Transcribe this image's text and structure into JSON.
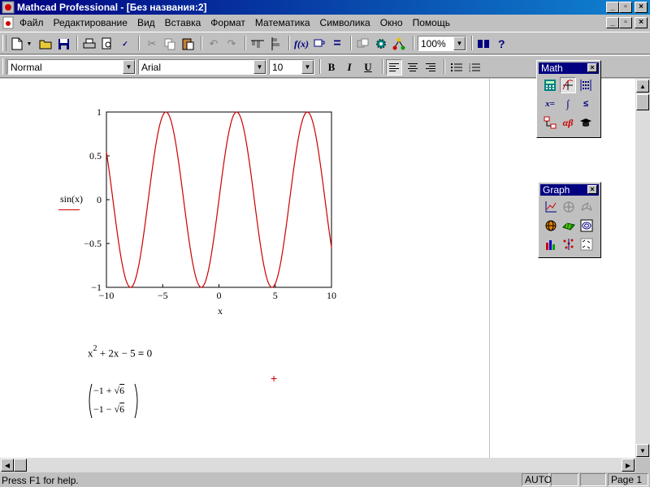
{
  "window": {
    "title": "Mathcad Professional - [Без названия:2]"
  },
  "menu": [
    "Файл",
    "Редактирование",
    "Вид",
    "Вставка",
    "Формат",
    "Математика",
    "Символика",
    "Окно",
    "Помощь"
  ],
  "toolbar": {
    "zoom": "100%"
  },
  "format_toolbar": {
    "style": "Normal",
    "font": "Arial",
    "size": "10",
    "bold": "B",
    "italic": "I",
    "underline": "U"
  },
  "palettes": {
    "math": {
      "title": "Math"
    },
    "graph": {
      "title": "Graph"
    }
  },
  "plot": {
    "trace_label": "sin(x)",
    "xlabel": "x",
    "trace_color": "#cc0000"
  },
  "chart_data": {
    "type": "line",
    "series": [
      {
        "name": "sin(x)",
        "function": "sin(x)",
        "color": "#cc0000"
      }
    ],
    "xlim": [
      -10,
      10
    ],
    "ylim": [
      -1,
      1
    ],
    "x_ticks": [
      "−10",
      "−5",
      "0",
      "5",
      "10"
    ],
    "y_ticks": [
      "1",
      "0.5",
      "0",
      "−0.5",
      "−1"
    ],
    "xlabel": "x",
    "grid": false
  },
  "equation": {
    "lhs_base": "x",
    "lhs_exp": "2",
    "rest": " + 2x − 5 ",
    "bool_eq": "=",
    "rhs": " 0"
  },
  "solution": {
    "row1_prefix": "−1 + ",
    "row2_prefix": "−1 − ",
    "radicand": "6"
  },
  "status": {
    "message": "Press F1 for help.",
    "mode": "AUTO",
    "page": "Page 1"
  }
}
